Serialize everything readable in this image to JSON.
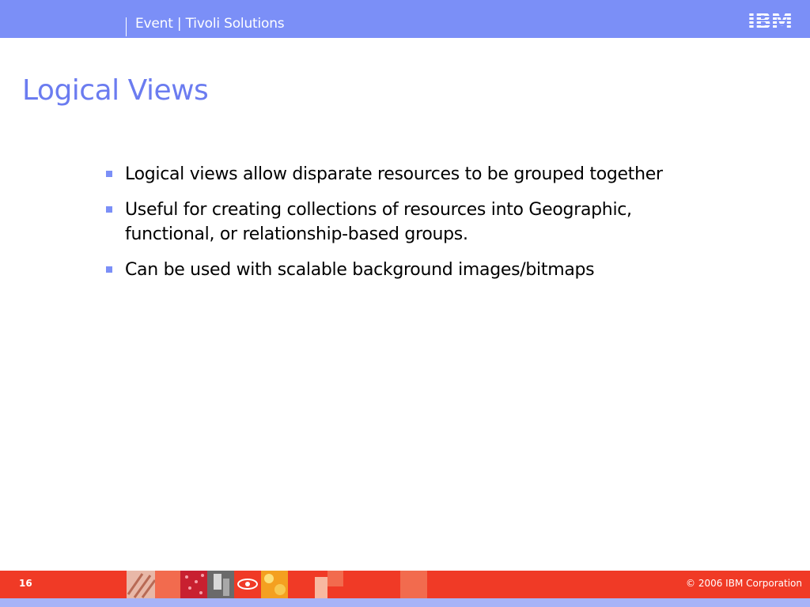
{
  "header": {
    "title": "Event | Tivoli Solutions",
    "logo": "IBM",
    "logo_icon": "ibm-logo-icon",
    "bar_color": "#7B8FF7"
  },
  "slide": {
    "title": "Logical Views",
    "title_color": "#6B7CF0",
    "bullets": [
      {
        "text": "Logical views allow disparate resources to be grouped together"
      },
      {
        "text": "Useful for creating collections of resources into Geographic, functional, or relationship-based groups."
      },
      {
        "text": "Can be used with scalable background images/bitmaps"
      }
    ],
    "bullet_icon": "square-bullet-icon"
  },
  "footer": {
    "page_number": "16",
    "copyright": "© 2006 IBM Corporation",
    "bar_color": "#F03A26",
    "decor_icon": "eye-icon"
  }
}
